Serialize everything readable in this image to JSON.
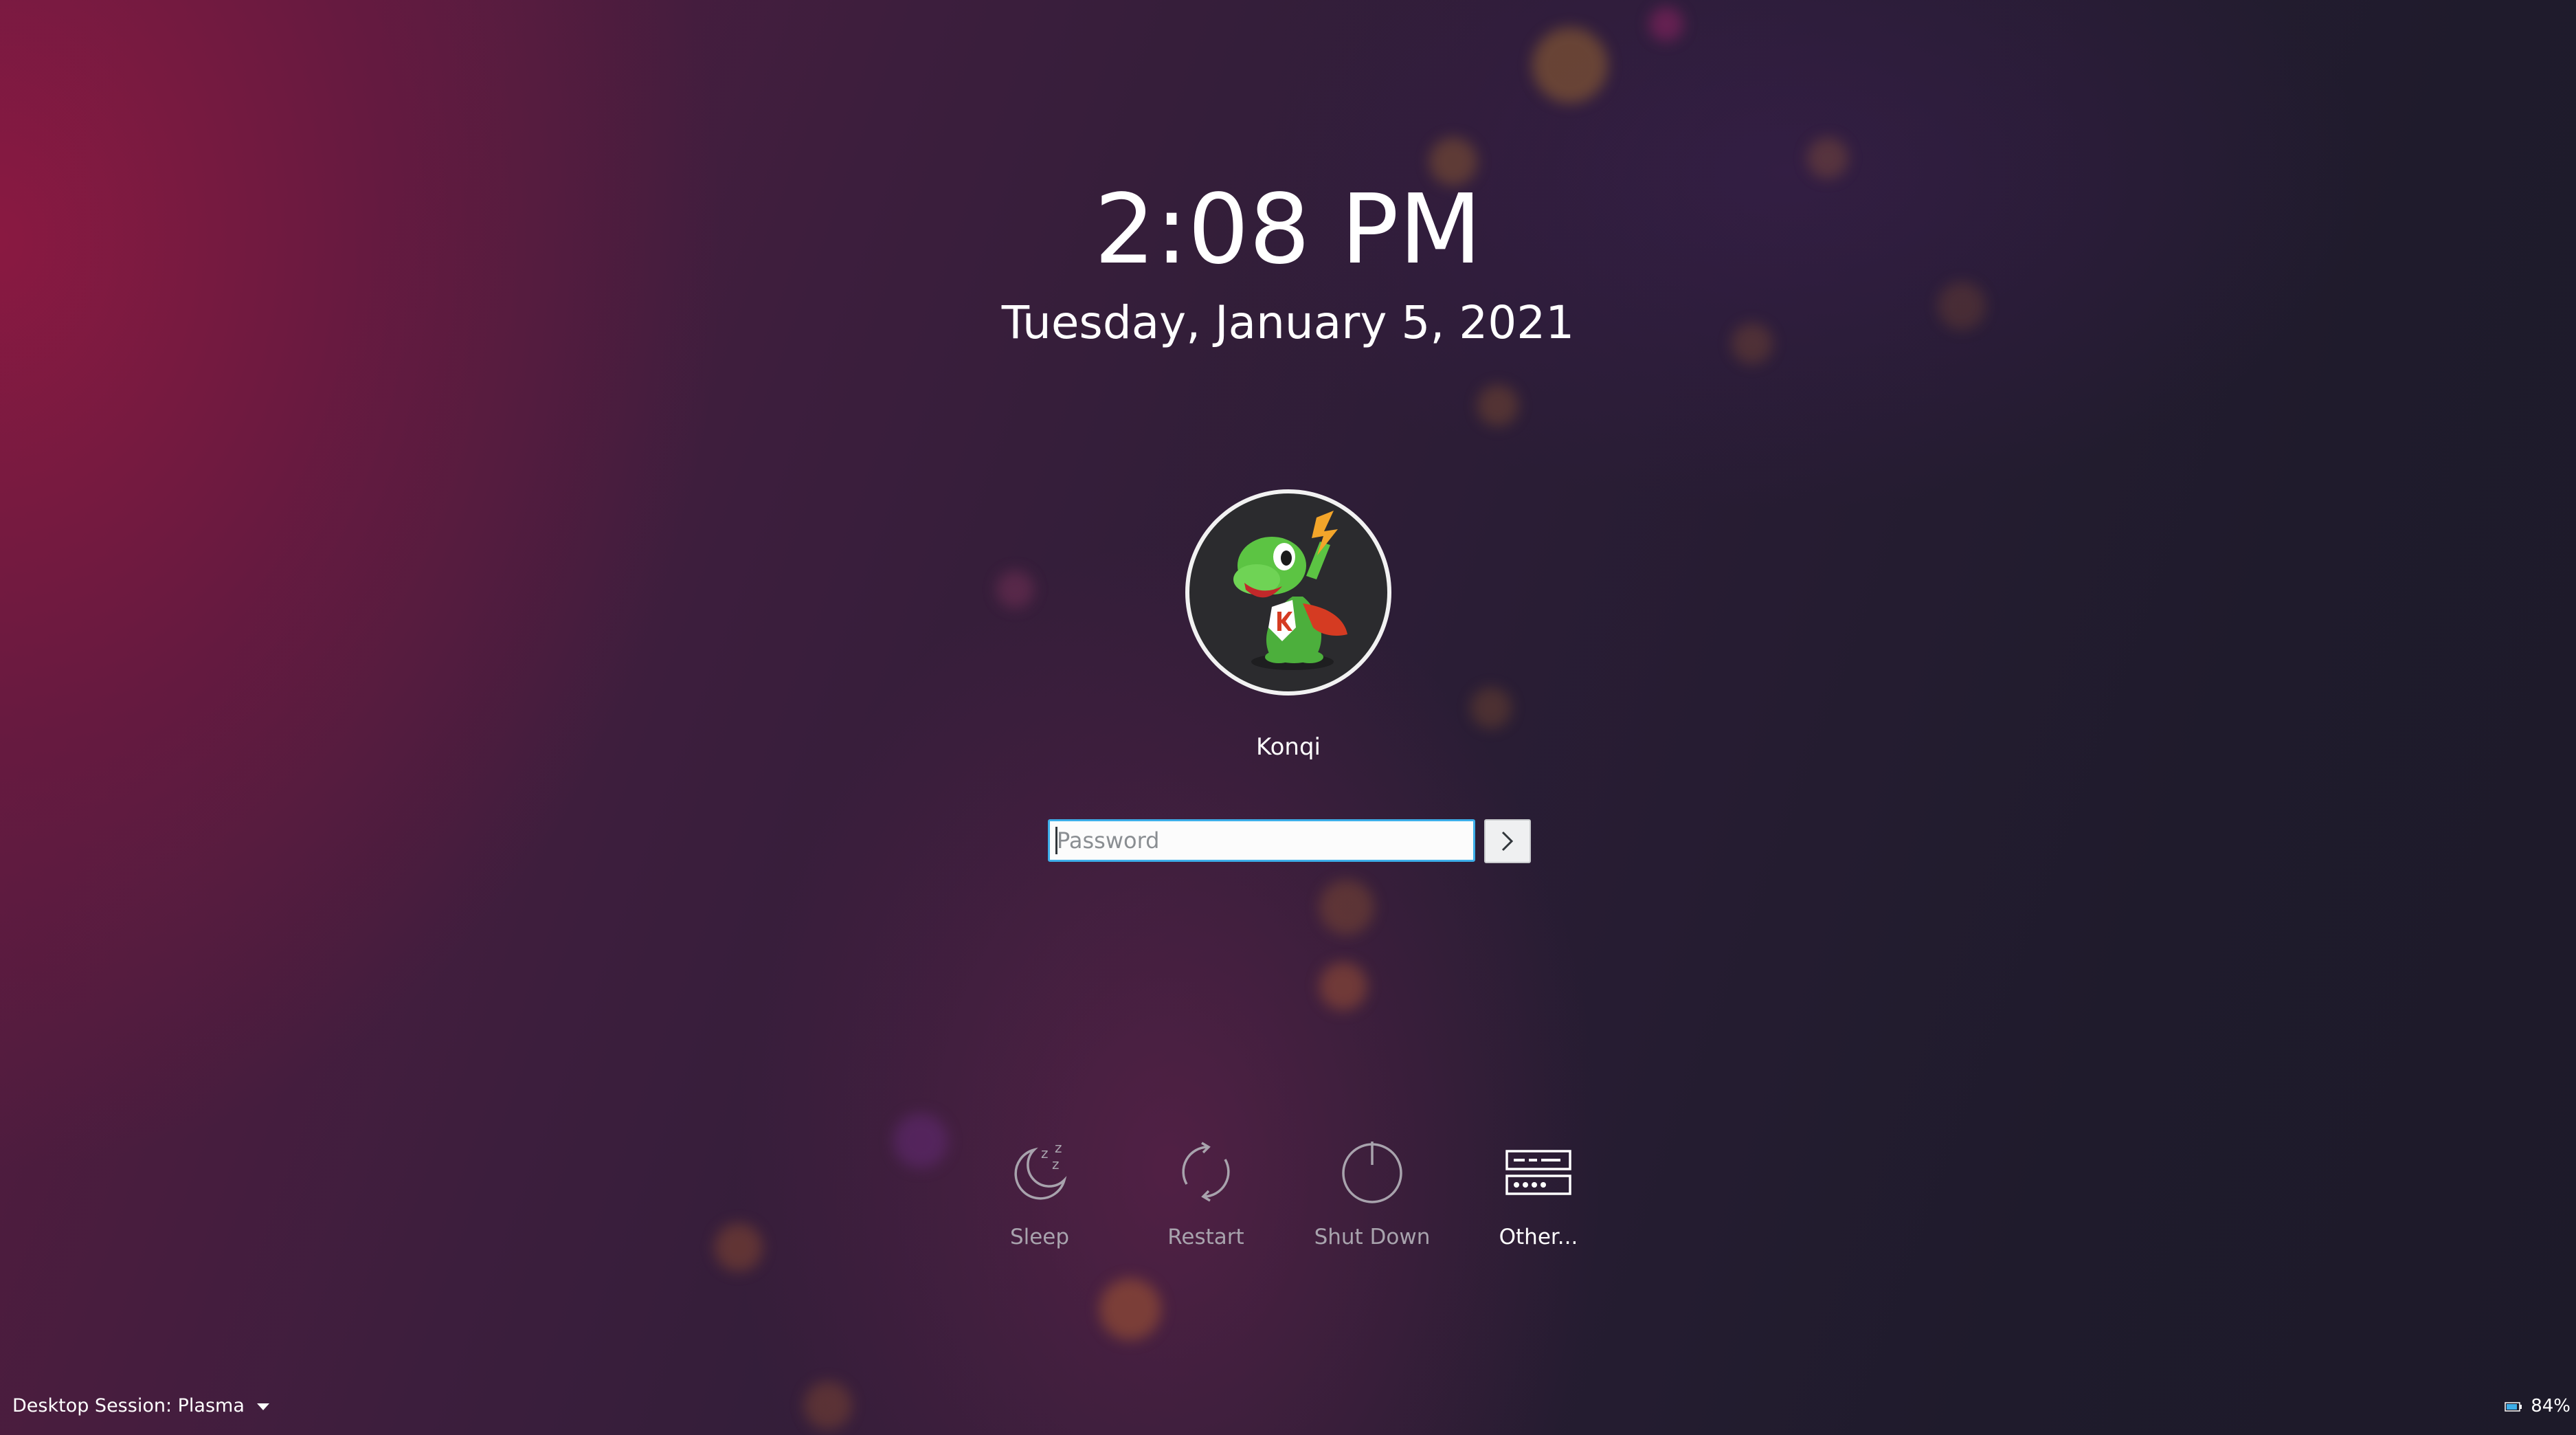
{
  "lockscreen": {
    "time": "2:08 PM",
    "date": "Tuesday, January 5, 2021"
  },
  "user": {
    "name": "Konqi",
    "avatar_icon": "konqi-dragon-avatar"
  },
  "login": {
    "password_placeholder": "Password",
    "password_value": "",
    "submit_icon": "chevron-right-icon"
  },
  "power_actions": [
    {
      "label": "Sleep",
      "icon": "sleep-moon-icon"
    },
    {
      "label": "Restart",
      "icon": "restart-icon"
    },
    {
      "label": "Shut Down",
      "icon": "power-icon"
    },
    {
      "label": "Other...",
      "icon": "server-other-icon"
    }
  ],
  "footer": {
    "session_label": "Desktop Session: Plasma",
    "battery_percent": "84%"
  },
  "colors": {
    "accent": "#3daee9",
    "text": "#ffffff",
    "muted_text": "#a8a3ad"
  }
}
